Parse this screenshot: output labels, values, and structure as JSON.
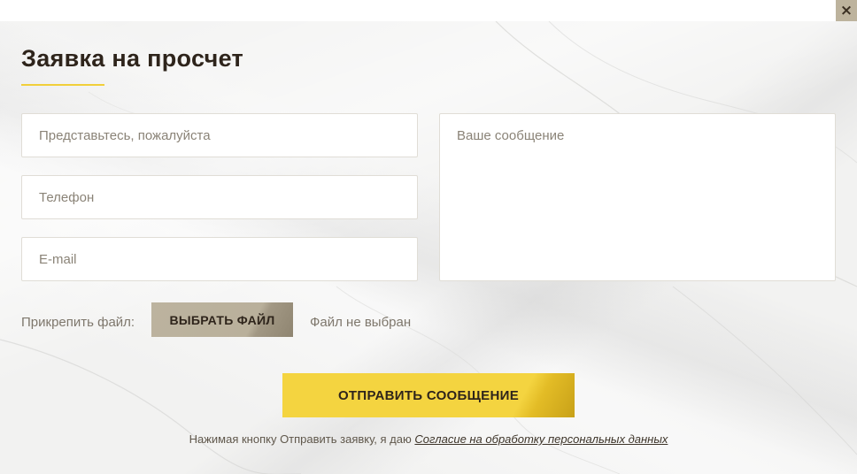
{
  "close": {
    "label": "×"
  },
  "form": {
    "title": "Заявка на просчет",
    "fields": {
      "name_placeholder": "Представьтесь, пожалуйста",
      "phone_placeholder": "Телефон",
      "email_placeholder": "E-mail",
      "message_placeholder": "Ваше сообщение"
    },
    "attach": {
      "label": "Прикрепить файл:",
      "button_label": "ВЫБРАТЬ ФАЙЛ",
      "status": "Файл не выбран"
    },
    "submit_label": "ОТПРАВИТЬ СООБЩЕНИЕ",
    "consent": {
      "text": "Нажимая кнопку Отправить заявку, я даю",
      "link": "Согласие на обработку персональных данных"
    }
  },
  "colors": {
    "accent": "#f4d440",
    "file_button": "#bcb39f",
    "title": "#2e241b"
  }
}
